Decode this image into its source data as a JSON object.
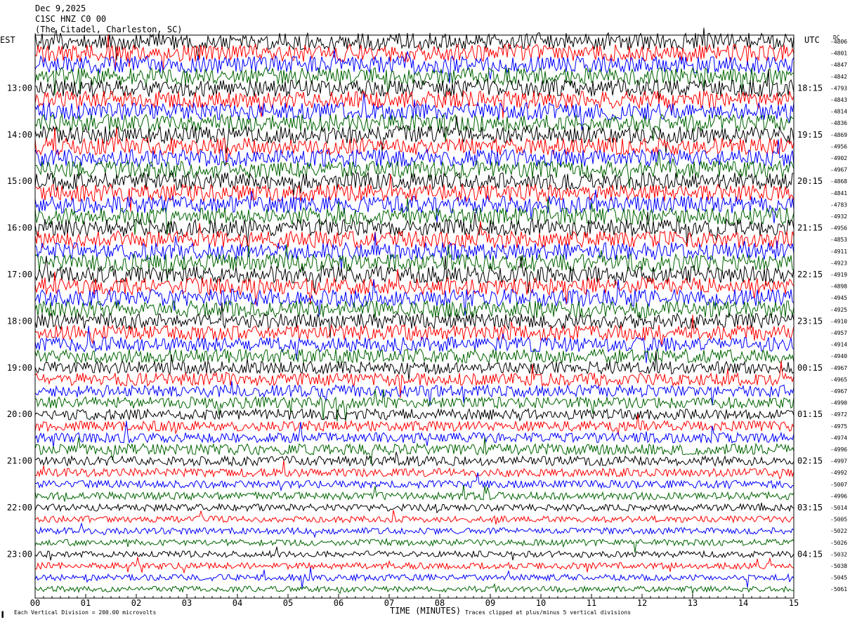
{
  "header": {
    "date": "Dec 9,2025",
    "station": "C1SC HNZ C0 00",
    "location": "(The Citadel, Charleston, SC)"
  },
  "axes": {
    "left_zone": "EST",
    "right_zone": "UTC",
    "right_header": "DC",
    "xlabel": "TIME (MINUTES)"
  },
  "footer": {
    "scale_note": "Each Vertical Division =  200.00 microvolts",
    "clip_note": "Traces clipped at plus/minus 5 vertical divisions",
    "mark": "▐"
  },
  "colors": {
    "trace_cycle": [
      "#000000",
      "#ff0000",
      "#0000ff",
      "#006400"
    ]
  },
  "chart_data": {
    "type": "line",
    "title": "Dec 9,2025",
    "xlabel": "TIME (MINUTES)",
    "xlim": [
      0,
      15
    ],
    "x_ticks": [
      "00",
      "01",
      "02",
      "03",
      "04",
      "05",
      "06",
      "07",
      "08",
      "09",
      "10",
      "11",
      "12",
      "13",
      "14",
      "15"
    ],
    "rows": 48,
    "row_minutes": 15,
    "left_labels": [
      "13:00",
      "14:00",
      "15:00",
      "16:00",
      "17:00",
      "18:00",
      "19:00",
      "20:00",
      "21:00",
      "22:00",
      "23:00"
    ],
    "right_labels": [
      "18:15",
      "19:15",
      "20:15",
      "21:15",
      "22:15",
      "23:15",
      "00:15",
      "01:15",
      "02:15",
      "03:15",
      "04:15"
    ],
    "hour_label_first_row": 4,
    "dc_offsets": [
      "-4806",
      "-4801",
      "-4847",
      "-4842",
      "-4793",
      "-4843",
      "-4814",
      "-4836",
      "-4869",
      "-4956",
      "-4902",
      "-4967",
      "-4868",
      "-4841",
      "-4783",
      "-4932",
      "-4956",
      "-4853",
      "-4911",
      "-4923",
      "-4919",
      "-4898",
      "-4945",
      "-4925",
      "-4910",
      "-4957",
      "-4914",
      "-4940",
      "-4967",
      "-4965",
      "-4967",
      "-4990",
      "-4972",
      "-4975",
      "-4974",
      "-4996",
      "-4997",
      "-4992",
      "-5007",
      "-4996",
      "-5014",
      "-5005",
      "-5022",
      "-5026",
      "-5032",
      "-5038",
      "-5045",
      "-5061"
    ],
    "row_amplitude": [
      1.35,
      1.35,
      1.35,
      1.35,
      1.35,
      1.35,
      1.35,
      1.35,
      1.35,
      1.35,
      1.35,
      1.35,
      1.35,
      1.35,
      1.35,
      1.35,
      1.35,
      1.35,
      1.35,
      1.35,
      1.35,
      1.35,
      1.35,
      1.35,
      1.2,
      1.2,
      1.15,
      1.1,
      1.0,
      1.0,
      0.95,
      0.9,
      0.85,
      0.8,
      0.8,
      0.85,
      0.75,
      0.65,
      0.6,
      0.6,
      0.55,
      0.5,
      0.5,
      0.5,
      0.5,
      0.5,
      0.5,
      0.45
    ],
    "clip_divisions": 5,
    "grid": false,
    "legend": "none"
  }
}
